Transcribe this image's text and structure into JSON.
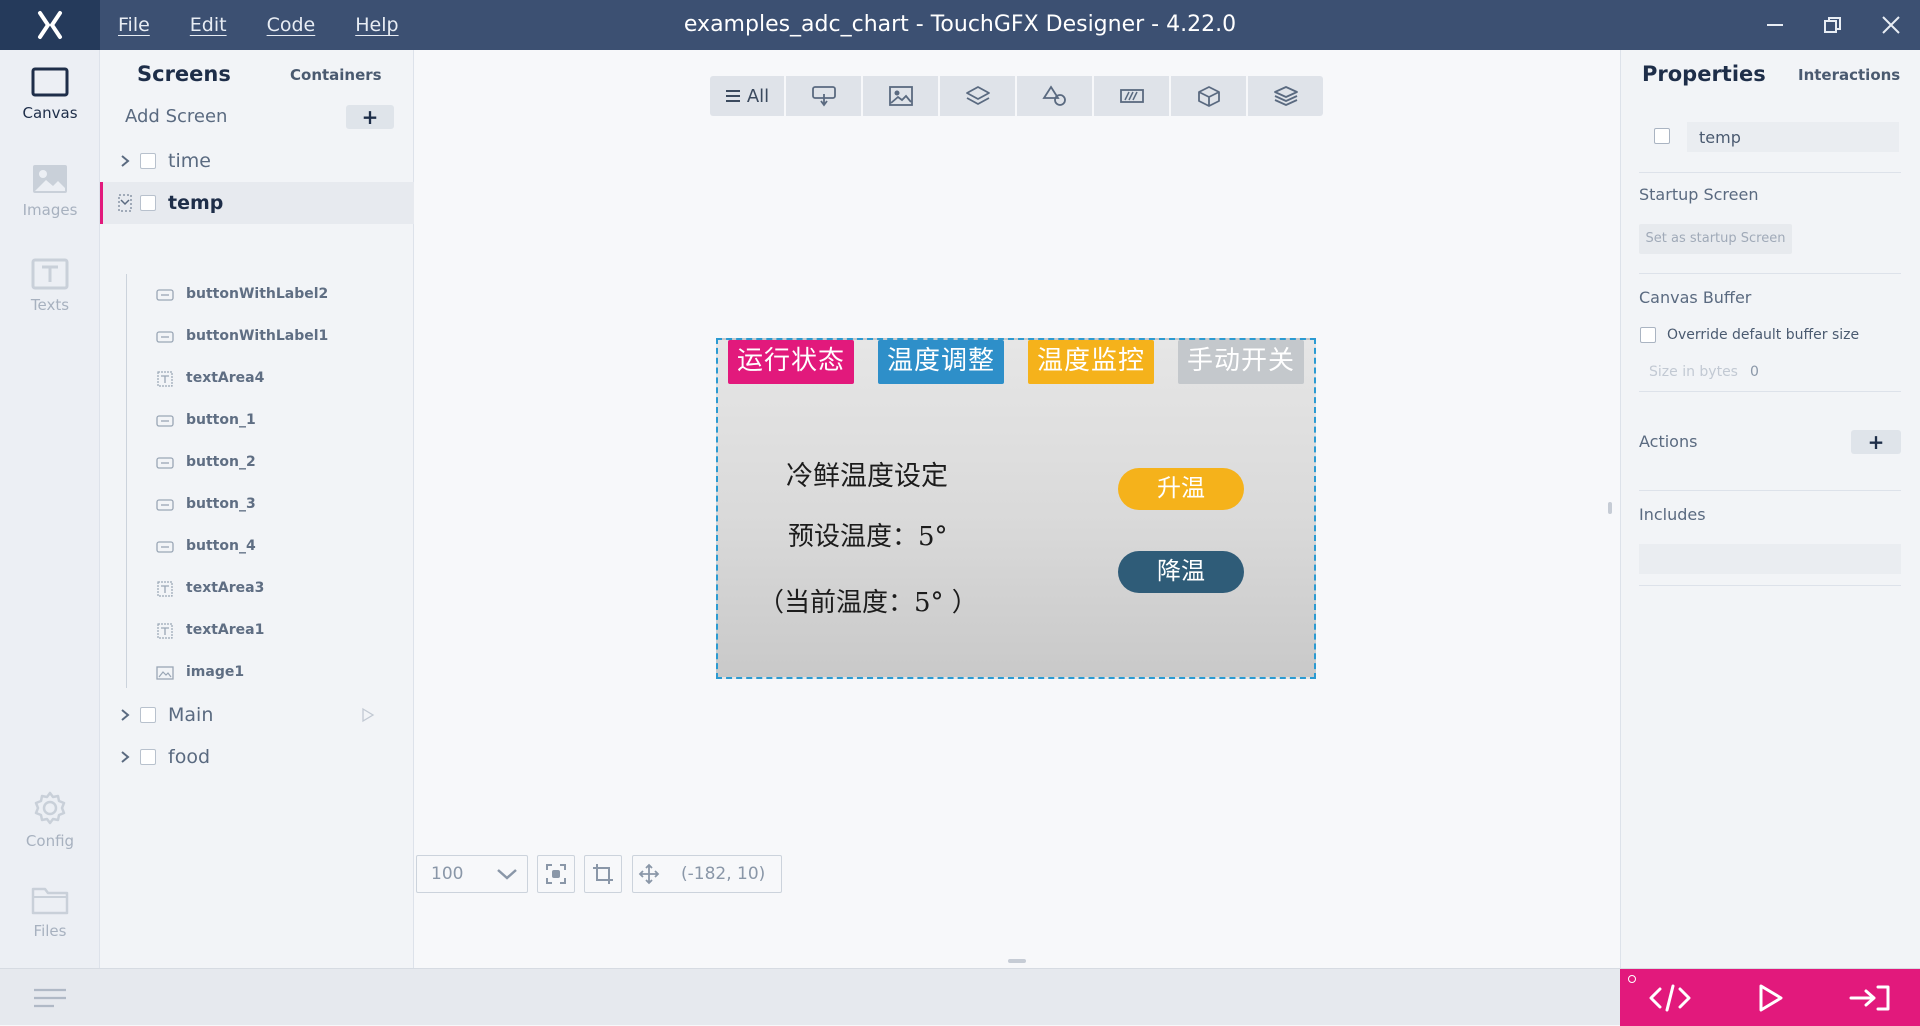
{
  "app": {
    "title": "examples_adc_chart - TouchGFX Designer - 4.22.0",
    "menu": [
      "File",
      "Edit",
      "Code",
      "Help"
    ]
  },
  "leftnav": {
    "items": [
      {
        "label": "Canvas",
        "icon": "canvas-icon",
        "active": true
      },
      {
        "label": "Images",
        "icon": "images-icon",
        "active": false
      },
      {
        "label": "Texts",
        "icon": "texts-icon",
        "active": false
      },
      {
        "label": "Config",
        "icon": "gear-icon",
        "active": false
      },
      {
        "label": "Files",
        "icon": "folder-icon",
        "active": false
      }
    ]
  },
  "screens_panel": {
    "tab_screens": "Screens",
    "tab_containers": "Containers",
    "add_screen_label": "Add Screen",
    "add_button": "+",
    "screens": [
      {
        "name": "time",
        "expanded": false,
        "selected": false
      },
      {
        "name": "temp",
        "expanded": true,
        "selected": true
      },
      {
        "name": "Main",
        "expanded": false,
        "selected": false,
        "startup": true
      },
      {
        "name": "food",
        "expanded": false,
        "selected": false
      }
    ],
    "temp_children": [
      {
        "name": "buttonWithLabel2",
        "type": "button-icon"
      },
      {
        "name": "buttonWithLabel1",
        "type": "button-icon"
      },
      {
        "name": "textArea4",
        "type": "text-icon"
      },
      {
        "name": "button_1",
        "type": "button-icon"
      },
      {
        "name": "button_2",
        "type": "button-icon"
      },
      {
        "name": "button_3",
        "type": "button-icon"
      },
      {
        "name": "button_4",
        "type": "button-icon"
      },
      {
        "name": "textArea3",
        "type": "text-icon"
      },
      {
        "name": "textArea1",
        "type": "text-icon"
      },
      {
        "name": "image1",
        "type": "image-icon"
      }
    ]
  },
  "canvas": {
    "filter_all": "All",
    "device": {
      "tabs": [
        {
          "label": "运行状态",
          "color": "#e2197c"
        },
        {
          "label": "温度调整",
          "color": "#2e8fc9"
        },
        {
          "label": "温度监控",
          "color": "#f5b21b"
        },
        {
          "label": "手动开关",
          "color": "#c4c8cc"
        }
      ],
      "heading": "冷鲜温度设定",
      "preset_text": "预设温度：5°",
      "current_text": "（当前温度：5°  ）",
      "raise_button": "升温",
      "lower_button": "降温",
      "raise_color": "#f5b21b",
      "lower_color": "#2f5c78"
    },
    "zoom": "100",
    "coords": "(-182, 10)"
  },
  "properties": {
    "tab_properties": "Properties",
    "tab_interactions": "Interactions",
    "name_value": "temp",
    "startup_section": "Startup Screen",
    "startup_button": "Set as startup Screen",
    "canvas_buffer_section": "Canvas Buffer",
    "override_label": "Override default buffer size",
    "size_label": "Size in bytes",
    "size_value": "0",
    "actions_section": "Actions",
    "actions_add": "+",
    "includes_section": "Includes"
  },
  "colors": {
    "titlebar": "#3c5072",
    "accent": "#e2197c",
    "selection": "#2b9bd2"
  }
}
